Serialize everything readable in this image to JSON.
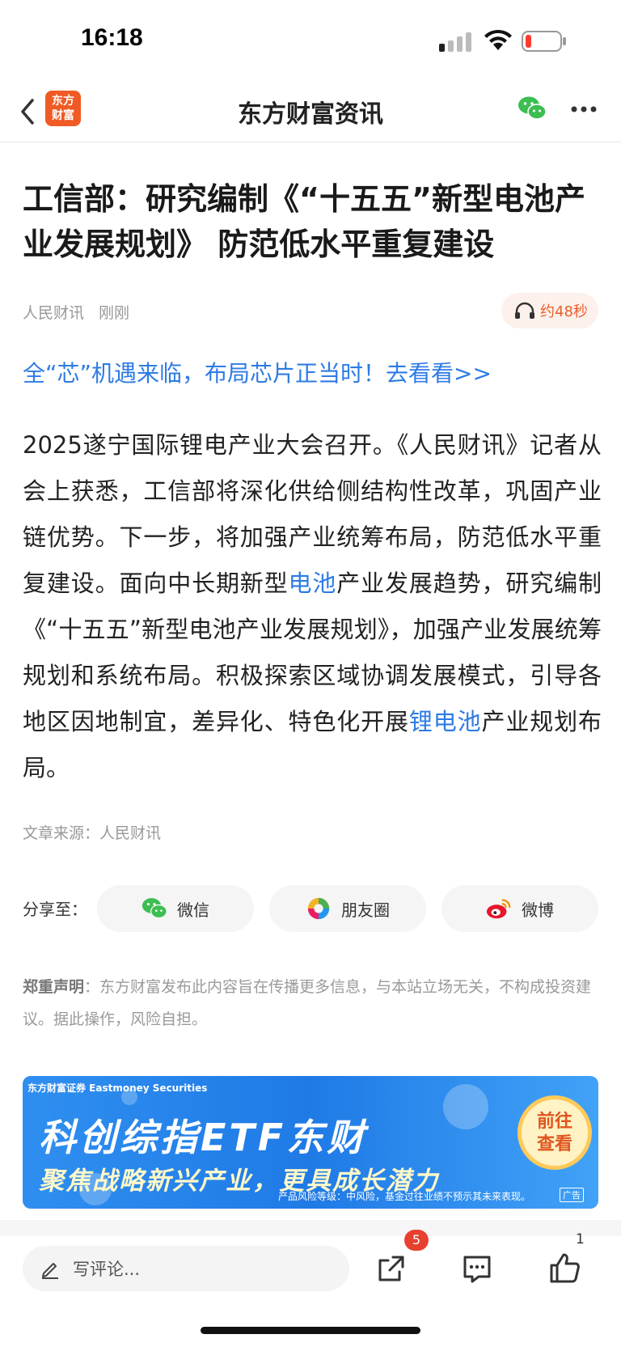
{
  "status_bar": {
    "time": "16:18"
  },
  "nav": {
    "logo_text_top": "东方",
    "logo_text_bottom": "财富",
    "title": "东方财富资讯"
  },
  "article": {
    "title": "工信部：研究编制《“十五五”新型电池产业发展规划》 防范低水平重复建设",
    "source_name": "人民财讯",
    "time": "刚刚",
    "audio_duration": "约48秒",
    "promo_link": "全“芯”机遇来临，布局芯片正当时！去看看>>",
    "body_part1": "2025遂宁国际锂电产业大会召开。《人民财讯》记者从会上获悉，工信部将深化供给侧结构性改革，巩固产业链优势。下一步，将加强产业统筹布局，防范低水平重复建设。面向中长期新型",
    "body_kw1": "电池",
    "body_part2": "产业发展趋势，研究编制《“十五五”新型电池产业发展规划》，加强产业发展统筹规划和系统布局。积极探索区域协调发展模式，引导各地区因地制宜，差异化、特色化开展",
    "body_kw2": "锂电池",
    "body_part3": "产业规划布局。",
    "article_source": "文章来源：人民财讯"
  },
  "share": {
    "label": "分享至：",
    "wechat": "微信",
    "moments": "朋友圈",
    "weibo": "微博"
  },
  "disclaimer": {
    "heading": "郑重声明",
    "text": "：东方财富发布此内容旨在传播更多信息，与本站立场无关，不构成投资建议。据此操作，风险自担。"
  },
  "ad": {
    "brand": "东方财富证券 Eastmoney Securities",
    "title": "科创综指ETF东财",
    "subtitle": "聚焦战略新兴产业，更具成长潜力",
    "cta_line1": "前往",
    "cta_line2": "查看",
    "risk": "产品风险等级：中风险，基金过往业绩不预示其未来表现。",
    "tag": "广告"
  },
  "bottom_bar": {
    "comment_placeholder": "写评论...",
    "share_badge": "5",
    "like_count": "1"
  },
  "colors": {
    "link": "#2e7be4",
    "accent": "#f05a24",
    "audio": "#e8602c"
  }
}
